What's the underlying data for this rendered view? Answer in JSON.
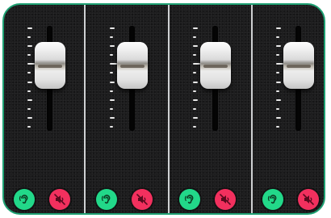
{
  "channels": [
    {
      "fader_level": 0.67,
      "monitor_icon": "ear-icon",
      "mute_icon": "speaker-muted-icon"
    },
    {
      "fader_level": 0.67,
      "monitor_icon": "ear-icon",
      "mute_icon": "speaker-muted-icon"
    },
    {
      "fader_level": 0.67,
      "monitor_icon": "ear-icon",
      "mute_icon": "speaker-muted-icon"
    },
    {
      "fader_level": 0.67,
      "monitor_icon": "ear-icon",
      "mute_icon": "speaker-muted-icon"
    }
  ],
  "colors": {
    "frame_border": "#1fa173",
    "panel_background": "#1b1b1c",
    "monitor_button": "#22d889",
    "mute_button": "#f2305e",
    "divider": "#cfd1d3"
  }
}
